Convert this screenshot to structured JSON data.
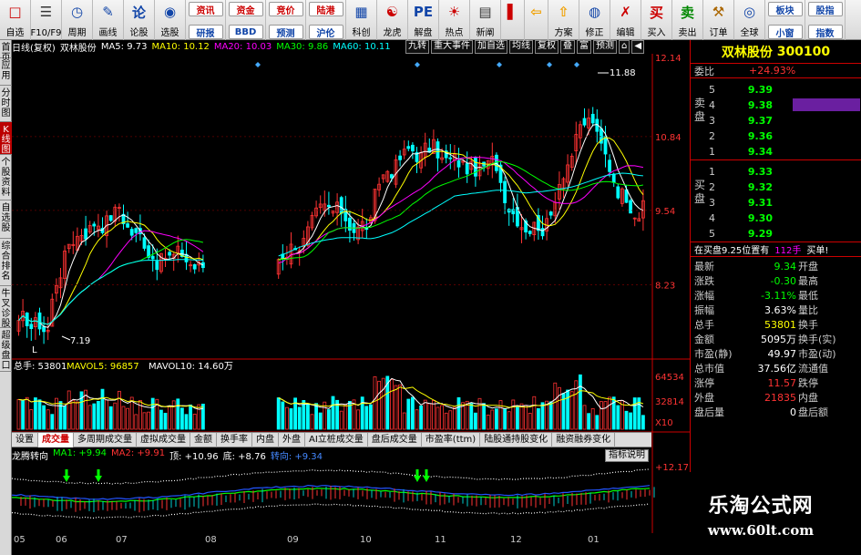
{
  "toolbar": [
    {
      "name": "zixuan",
      "label": "自选",
      "icon": "□",
      "color": "#c00"
    },
    {
      "name": "f10",
      "label": "F10/F9",
      "icon": "☰",
      "color": "#333"
    },
    {
      "name": "zhouqi",
      "label": "周期",
      "icon": "◷",
      "color": "#1145a8"
    },
    {
      "name": "huaxian",
      "label": "画线",
      "icon": "✎",
      "color": "#1145a8"
    },
    {
      "name": "lungu",
      "label": "论股",
      "icon": "论",
      "color": "#1145a8"
    },
    {
      "name": "xuangu",
      "label": "选股",
      "icon": "◉",
      "color": "#1145a8"
    }
  ],
  "toolbar_pairs": [
    {
      "top": "资讯",
      "bottom": "研报"
    },
    {
      "top": "资金",
      "bottom": "BBD"
    },
    {
      "top": "竞价",
      "bottom": "预测"
    },
    {
      "top": "陆港",
      "bottom": "沪伦"
    }
  ],
  "toolbar2": [
    {
      "name": "kechuang",
      "label": "科创",
      "icon": "▦",
      "color": "#1145a8"
    },
    {
      "name": "longhu",
      "label": "龙虎",
      "icon": "☯",
      "color": "#c00"
    },
    {
      "name": "jiepan",
      "label": "解盘",
      "icon": "PE",
      "color": "#1145a8"
    },
    {
      "name": "redian",
      "label": "热点",
      "icon": "☀",
      "color": "#c00"
    },
    {
      "name": "xinwen",
      "label": "新阐",
      "icon": "▤",
      "color": "#333"
    },
    {
      "name": "blank1",
      "label": "",
      "icon": "▌",
      "color": "#c00"
    },
    {
      "name": "back",
      "label": "",
      "icon": "⇦",
      "color": "#f0a000"
    },
    {
      "name": "fangan",
      "label": "方案",
      "icon": "⇧",
      "color": "#f0a000"
    },
    {
      "name": "xiuzheng",
      "label": "修正",
      "icon": "◍",
      "color": "#1145a8"
    },
    {
      "name": "bianji",
      "label": "编辑",
      "icon": "✗",
      "color": "#c00"
    },
    {
      "name": "mairu",
      "label": "买入",
      "icon": "买",
      "color": "#c00"
    },
    {
      "name": "maichu",
      "label": "卖出",
      "icon": "卖",
      "color": "#080"
    },
    {
      "name": "dingdan",
      "label": "订单",
      "icon": "⚒",
      "color": "#a60"
    },
    {
      "name": "quanqiu",
      "label": "全球",
      "icon": "◎",
      "color": "#1145a8"
    }
  ],
  "toolbar_right_pairs": [
    {
      "top": "板块",
      "bottom": "小窗"
    },
    {
      "top": "股指",
      "bottom": "指数"
    }
  ],
  "left_tabs": [
    "首页",
    "应用",
    "分时图",
    "K线图",
    "个股资料",
    "自选股",
    "综合排名",
    "牛叉诊股",
    "超级盘口"
  ],
  "active_left_tab": 3,
  "chart_header": {
    "period": "日线(复权)",
    "name": "双林股份",
    "ma5": "MA5: 9.73",
    "ma10": "MA10: 10.12",
    "ma20": "MA20: 10.03",
    "ma30": "MA30: 9.86",
    "ma60": "MA60: 10.11"
  },
  "chart_buttons": [
    "九转",
    "重大事件",
    "加自选",
    "均线",
    "复权",
    "叠",
    "富",
    "预测"
  ],
  "price_axis": [
    "12.14",
    "10.84",
    "9.54",
    "8.23"
  ],
  "price_annotations": {
    "high": "11.88",
    "low": "7.19",
    "l_mark": "L"
  },
  "volume_header": {
    "total": "总手: 53801",
    "mavol5": "MAVOL5: 96857",
    "mavol10": "MAVOL10: 14.60万"
  },
  "volume_axis": [
    "64534",
    "32814",
    "X10"
  ],
  "bottom_tabs": [
    "设置",
    "成交量",
    "多周期成交量",
    "虚拟成交量",
    "金额",
    "换手率",
    "内盘",
    "外盘",
    "AI立桩成交量",
    "盘后成交量",
    "市盈率(ttm)",
    "陆股通持股变化",
    "融资融券变化"
  ],
  "active_bottom_tab": 1,
  "indicator_header": {
    "name": "龙腾转向",
    "ma1": "MA1: +9.94",
    "ma2": "MA2: +9.91",
    "top": "顶: +10.96",
    "bottom": "底: +8.76",
    "turn": "转向: +9.34"
  },
  "indicator_button": "指标说明",
  "indicator_axis": "+12.17",
  "x_labels": [
    "05",
    "06",
    "07",
    "08",
    "09",
    "10",
    "11",
    "12",
    "01"
  ],
  "panel": {
    "name": "双林股份",
    "code": "300100",
    "weibi_label": "委比",
    "weibi_value": "+24.93%",
    "sell_label": "卖盘",
    "buy_label": "买盘",
    "sell": [
      {
        "n": "5",
        "p": "9.39",
        "v": ""
      },
      {
        "n": "4",
        "p": "9.38",
        "v": ""
      },
      {
        "n": "3",
        "p": "9.37",
        "v": ""
      },
      {
        "n": "2",
        "p": "9.36",
        "v": ""
      },
      {
        "n": "1",
        "p": "9.34",
        "v": ""
      }
    ],
    "buy": [
      {
        "n": "1",
        "p": "9.33",
        "v": ""
      },
      {
        "n": "2",
        "p": "9.32",
        "v": ""
      },
      {
        "n": "3",
        "p": "9.31",
        "v": ""
      },
      {
        "n": "4",
        "p": "9.30",
        "v": ""
      },
      {
        "n": "5",
        "p": "9.29",
        "v": ""
      }
    ],
    "note_text": "在买盘9.25位置有",
    "note_count": "112手",
    "note_action": "买单!",
    "stats": [
      {
        "k1": "最新",
        "v1": "9.34",
        "c1": "g",
        "k2": "开盘"
      },
      {
        "k1": "涨跌",
        "v1": "-0.30",
        "c1": "g",
        "k2": "最高"
      },
      {
        "k1": "涨幅",
        "v1": "-3.11%",
        "c1": "g",
        "k2": "最低"
      },
      {
        "k1": "振幅",
        "v1": "3.63%",
        "c1": "w",
        "k2": "量比"
      },
      {
        "k1": "总手",
        "v1": "53801",
        "c1": "y",
        "k2": "换手"
      },
      {
        "k1": "金额",
        "v1": "5095万",
        "c1": "w",
        "k2": "换手(实)"
      },
      {
        "k1": "市盈(静)",
        "v1": "49.97",
        "c1": "w",
        "k2": "市盈(动)"
      },
      {
        "k1": "总市值",
        "v1": "37.56亿",
        "c1": "w",
        "k2": "流通值"
      },
      {
        "k1": "涨停",
        "v1": "11.57",
        "c1": "r",
        "k2": "跌停"
      },
      {
        "k1": "外盘",
        "v1": "21835",
        "c1": "r",
        "k2": "内盘"
      },
      {
        "k1": "盘后量",
        "v1": "0",
        "c1": "w",
        "k2": "盘后额"
      }
    ]
  },
  "watermark": {
    "title": "乐淘公式网",
    "url": "www.60lt.com"
  },
  "colors": {
    "up": "#ff3333",
    "down": "#00ffff",
    "ma5": "#ffffff",
    "ma10": "#ffff00",
    "ma20": "#ff00ff",
    "ma30": "#00ff00",
    "ma60": "#00ffff",
    "panel_border": "#cc0000"
  }
}
